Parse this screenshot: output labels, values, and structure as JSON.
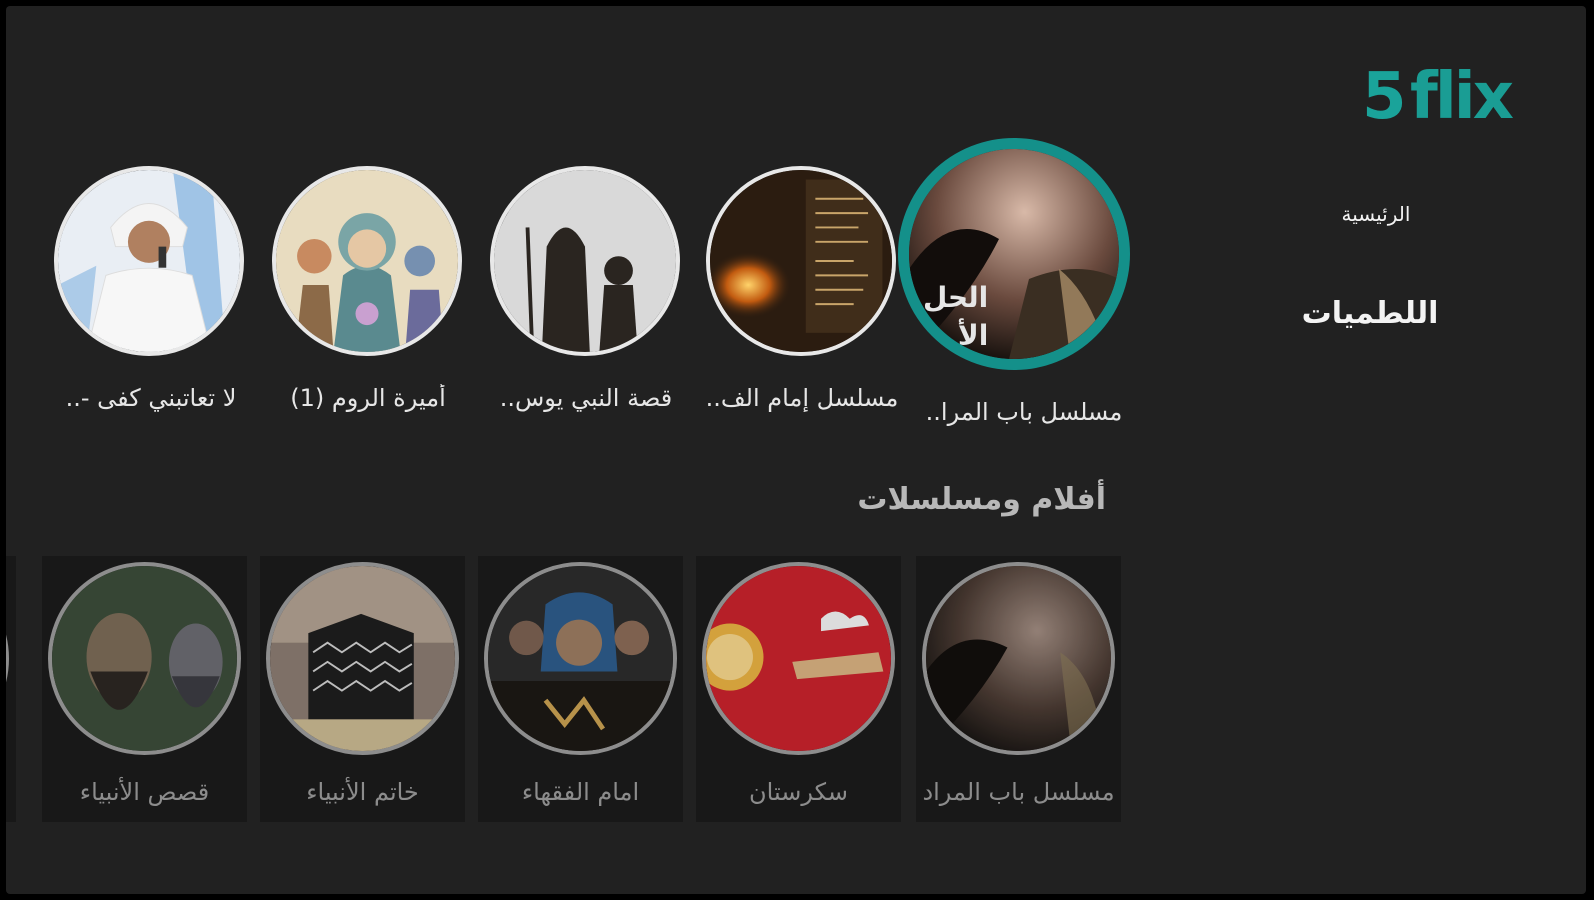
{
  "brand": {
    "logo_number": "5",
    "logo_word": "flix"
  },
  "nav": {
    "home": "الرئيسية",
    "latmiyat": "اللطميات"
  },
  "featured": [
    {
      "title": "مسلسل باب المرا..",
      "overlay": "الحل\nالأ"
    },
    {
      "title": "مسلسل إمام الف.."
    },
    {
      "title": "قصة النبي يوس.."
    },
    {
      "title": "أميرة الروم (1)"
    },
    {
      "title": "لا تعاتبني كفى -.."
    }
  ],
  "section": {
    "title": "أفلام ومسلسلات"
  },
  "cards": [
    {
      "label": "مسلسل باب المراد"
    },
    {
      "label": "سكرستان"
    },
    {
      "label": "امام الفقهاء"
    },
    {
      "label": "خاتم الأنبياء"
    },
    {
      "label": "قصص الأنبياء"
    }
  ],
  "colors": {
    "background": "#212121",
    "accent": "#14908a",
    "card": "#181818"
  }
}
